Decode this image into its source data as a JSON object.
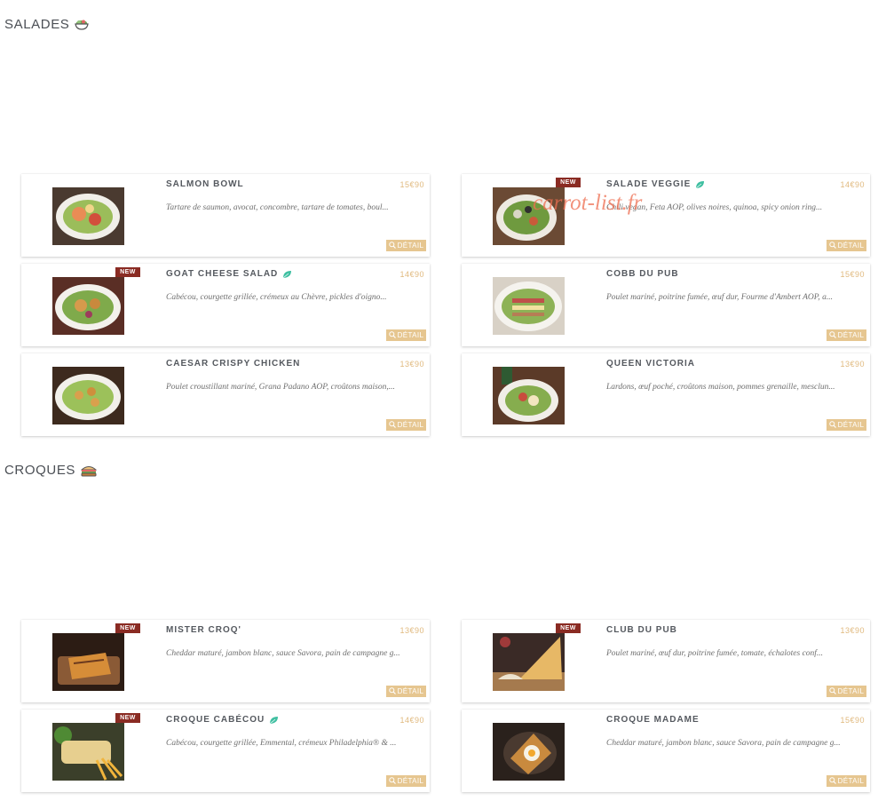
{
  "sections": {
    "salades": {
      "title": "SALADES",
      "icon": "salad-bowl-icon"
    },
    "croques": {
      "title": "CROQUES",
      "icon": "sandwich-icon"
    }
  },
  "badge_new": "NEW",
  "detail_label": "DÉTAIL",
  "watermark": "carrot-list.fr",
  "colors": {
    "price": "#e0b97e",
    "detail_button": "#e6c690",
    "new_badge": "#8a2b23",
    "leaf": "#3fbfa1"
  },
  "salades": [
    {
      "name": "SALMON BOWL",
      "price": "15€90",
      "desc": "Tartare de saumon, avocat, concombre, tartare de tomates, boul...",
      "new": false,
      "veggie": false
    },
    {
      "name": "SALADE VEGGIE",
      "price": "14€90",
      "desc": "Chili vegan, Feta AOP, olives noires, quinoa, spicy onion ring...",
      "new": true,
      "veggie": true
    },
    {
      "name": "GOAT CHEESE SALAD",
      "price": "14€90",
      "desc": "Cabécou, courgette grillée, crémeux au Chèvre, pickles d'oigno...",
      "new": true,
      "veggie": true
    },
    {
      "name": "COBB DU PUB",
      "price": "15€90",
      "desc": "Poulet mariné, poitrine fumée, œuf dur, Fourme d'Ambert AOP, a...",
      "new": false,
      "veggie": false
    },
    {
      "name": "CAESAR CRISPY CHICKEN",
      "price": "13€90",
      "desc": "Poulet croustillant mariné, Grana Padano AOP, croûtons maison,...",
      "new": false,
      "veggie": false
    },
    {
      "name": "QUEEN VICTORIA",
      "price": "13€90",
      "desc": "Lardons, œuf poché, croûtons maison, pommes grenaille, mesclun...",
      "new": false,
      "veggie": false
    }
  ],
  "croques": [
    {
      "name": "MISTER CROQ'",
      "price": "13€90",
      "desc": "Cheddar maturé, jambon blanc, sauce Savora, pain de campagne g...",
      "new": true,
      "veggie": false
    },
    {
      "name": "CLUB DU PUB",
      "price": "13€90",
      "desc": "Poulet mariné, œuf dur, poitrine fumée, tomate, échalotes conf...",
      "new": true,
      "veggie": false
    },
    {
      "name": "CROQUE CABÉCOU",
      "price": "14€90",
      "desc": "Cabécou, courgette grillée, Emmental, crémeux Philadelphia® & ...",
      "new": true,
      "veggie": true
    },
    {
      "name": "CROQUE MADAME",
      "price": "15€90",
      "desc": "Cheddar maturé, jambon blanc, sauce Savora, pain de campagne g...",
      "new": false,
      "veggie": false
    }
  ]
}
